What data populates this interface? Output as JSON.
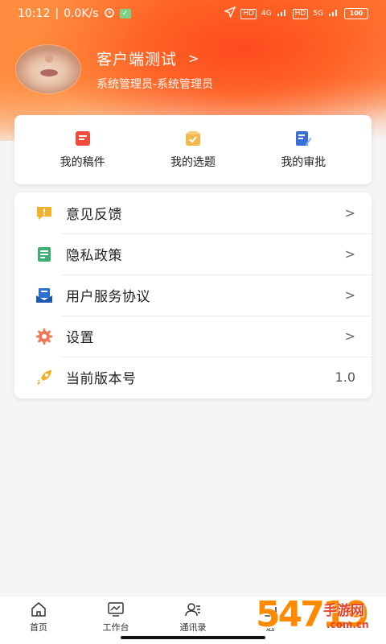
{
  "status_bar": {
    "time": "10:12",
    "speed": "0.0K/s",
    "hd1": "HD",
    "net1": "4G",
    "hd2": "HD",
    "net2": "5G",
    "battery": "100"
  },
  "profile": {
    "name": "客户端测试",
    "role": "系统管理员-系统管理员"
  },
  "quick_actions": [
    {
      "label": "我的稿件",
      "icon": "document-icon",
      "color": "#ef4a3c"
    },
    {
      "label": "我的选题",
      "icon": "topic-check-icon",
      "color": "#f2b84a"
    },
    {
      "label": "我的审批",
      "icon": "approval-edit-icon",
      "color": "#3a6fd8"
    }
  ],
  "menu": [
    {
      "label": "意见反馈",
      "icon": "feedback-icon",
      "color": "#f0b22d"
    },
    {
      "label": "隐私政策",
      "icon": "privacy-doc-icon",
      "color": "#3fae72"
    },
    {
      "label": "用户服务协议",
      "icon": "agreement-icon",
      "color": "#2d6fd0"
    },
    {
      "label": "设置",
      "icon": "gear-icon",
      "color": "#ef7a55"
    },
    {
      "label": "当前版本号",
      "icon": "rocket-icon",
      "color": "#f0b22d",
      "value": "1.0"
    }
  ],
  "bottom_nav": [
    {
      "label": "首页",
      "icon": "home-icon"
    },
    {
      "label": "工作台",
      "icon": "workbench-icon"
    },
    {
      "label": "通讯录",
      "icon": "contacts-icon"
    },
    {
      "label": "选",
      "icon": "topic-icon"
    }
  ],
  "watermark": {
    "num": "54719",
    "text": "手游网",
    "url": ".com.cn"
  }
}
